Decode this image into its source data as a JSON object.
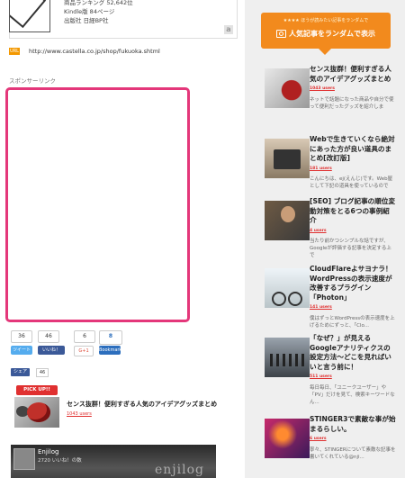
{
  "book": {
    "lines": [
      "商品ランキング 52,642位",
      "Kindle版 84ページ",
      "出版社 日経BP社"
    ],
    "store_icon": "a"
  },
  "url_row": {
    "icon_label": "URL",
    "url": "http://www.castella.co.jp/shop/fukuoka.shtml"
  },
  "sponsor_label": "スポンサーリンク",
  "share": {
    "twitter": {
      "count": "36",
      "label": "ツイート"
    },
    "facebook": {
      "count": "46",
      "label": "いいね！"
    },
    "gplus": {
      "count": "6",
      "label": "G+1"
    },
    "hatena": {
      "count": "8",
      "label": "Bookmark"
    },
    "fb_share": {
      "label": "シェア",
      "count": "46"
    }
  },
  "pickup": {
    "badge": "PICK UP!!",
    "title": "センス抜群！便利すぎる人気のアイデアグッズまとめ",
    "users": "1043 users"
  },
  "enjilog": {
    "name": "Enjilog",
    "sub": "2720 いいね！の数",
    "big": "enjilog"
  },
  "sidebar": {
    "banner": {
      "sub": "★★★★ ほうが読みたい記事をランダムで",
      "title": "人気記事をランダムで表示"
    },
    "articles": [
      {
        "title": "センス抜群！便利すぎる人気のアイデアグッズまとめ",
        "users": "1043 users",
        "desc": "ネットで話題になった商品や自分で使って便利だったグッズを紹介しま"
      },
      {
        "title": "Webで生きていくなら絶対にあった方が良い道具のまとめ[改訂版]",
        "users": "181 users",
        "desc": "こんにちは、ej(えんじ)です。Web屋として下記の道具を使っているので"
      },
      {
        "title": "[SEO] ブログ記事の順位変動対策をとる6つの事例紹介",
        "users": "4 users",
        "desc": "当たり前かつシンプルな話ですが、Googleが評価する記事を決定する上で"
      },
      {
        "title": "CloudFlareよサヨナラ！WordPressの表示速度が改善するプラグイン「Photon」",
        "users": "141 users",
        "desc": "僕はずっとWordPressの表示速度を上げるためにずっと、「Clo..."
      },
      {
        "title": "「なぜ？」が見えるGoogleアナリティクスの設定方法〜どこを見ればいいと言う前に！",
        "users": "511 users",
        "desc": "毎日毎日、「ユニークユーザー」や「PV」だけを見て、検索キーワードなん..."
      },
      {
        "title": "STINGER3で素敵な事が始まるらしい。",
        "users": "6 users",
        "desc": "寧々、STINGERについて素敵な記事を書いてくれている@nji..."
      }
    ]
  },
  "colors": {
    "ad_border": "#e4377a",
    "banner": "#f28a1d",
    "users_red": "#e03030"
  }
}
